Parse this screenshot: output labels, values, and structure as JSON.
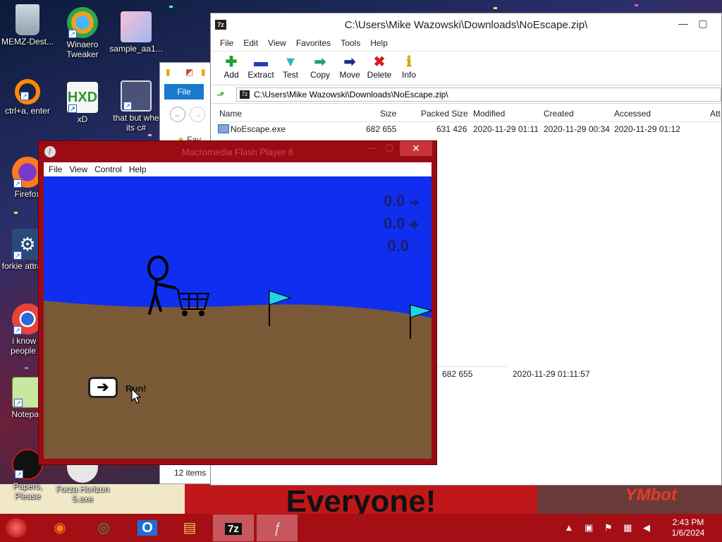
{
  "desktop": {
    "icons": [
      {
        "label": "MEMZ-Dest..."
      },
      {
        "label": "Winaero Tweaker"
      },
      {
        "label": "sample_aa1..."
      },
      {
        "label": "ctrl+a, enter"
      },
      {
        "label": "xD"
      },
      {
        "label": "that but whe its c#"
      },
      {
        "label": "Firefox"
      },
      {
        "label": "forkie attracta"
      },
      {
        "label": "i know y people w"
      },
      {
        "label": "Notepad"
      },
      {
        "label": "Papers, Please"
      },
      {
        "label": "Forza Horizon 5.exe"
      }
    ],
    "banner_text": "Everyone!",
    "banner_right_text": "YMbot"
  },
  "zip_window": {
    "title": "C:\\Users\\Mike Wazowski\\Downloads\\NoEscape.zip\\",
    "app_badge": "7z",
    "menu": [
      "File",
      "Edit",
      "View",
      "Favorites",
      "Tools",
      "Help"
    ],
    "toolbar": [
      {
        "label": "Add",
        "icon": "add-plus-icon",
        "glyph": "✚",
        "color": "#1f9e2c"
      },
      {
        "label": "Extract",
        "icon": "extract-minus-icon",
        "glyph": "▬",
        "color": "#1d3fb8"
      },
      {
        "label": "Test",
        "icon": "test-check-icon",
        "glyph": "▼",
        "color": "#2bb3c9"
      },
      {
        "label": "Copy",
        "icon": "copy-arrow-icon",
        "glyph": "➡",
        "color": "#2a9a8a"
      },
      {
        "label": "Move",
        "icon": "move-arrow-icon",
        "glyph": "➡",
        "color": "#1a2a8a"
      },
      {
        "label": "Delete",
        "icon": "delete-x-icon",
        "glyph": "✖",
        "color": "#d61f1f"
      },
      {
        "label": "Info",
        "icon": "info-icon",
        "glyph": "ℹ",
        "color": "#d4a50a"
      }
    ],
    "address": "C:\\Users\\Mike Wazowski\\Downloads\\NoEscape.zip\\",
    "columns": [
      "Name",
      "Size",
      "Packed Size",
      "Modified",
      "Created",
      "Accessed",
      "Att"
    ],
    "rows": [
      {
        "name": "NoEscape.exe",
        "size": "682 655",
        "packed": "631 426",
        "modified": "2020-11-29 01:11",
        "created": "2020-11-29 00:34",
        "accessed": "2020-11-29 01:12"
      }
    ],
    "status": {
      "size": "682 655",
      "modified": "2020-11-29 01:11:57"
    }
  },
  "explorer": {
    "file_tab": "File",
    "items_count": "12 items",
    "nav_partial": "Fav"
  },
  "flash_window": {
    "title": "Macromedia Flash Player 8",
    "menu": [
      "File",
      "View",
      "Control",
      "Help"
    ],
    "readouts": [
      {
        "value": "0.0",
        "arrow": "➔"
      },
      {
        "value": "0.0",
        "arrow": "✚"
      },
      {
        "value": "0.0",
        "arrow": "↓"
      }
    ],
    "run_button_glyph": "➔",
    "run_label": "Run!",
    "colors": {
      "sky": "#0f2ef0",
      "ground": "#7a5a36",
      "flag": "#1fd6e4"
    }
  },
  "taskbar": {
    "apps": [
      {
        "name": "firefox-icon",
        "glyph": "◉",
        "color": "#ff7a1a"
      },
      {
        "name": "chrome-icon",
        "glyph": "◎",
        "color": "#2ea84a"
      },
      {
        "name": "outlook-icon",
        "glyph": "O",
        "color": "#1f6fd0"
      },
      {
        "name": "file-explorer-icon",
        "glyph": "▤",
        "color": "#f0c24a"
      },
      {
        "name": "7zip-icon",
        "glyph": "7z",
        "color": "#ffffff"
      },
      {
        "name": "flash-icon",
        "glyph": "ƒ",
        "color": "#dddddd"
      }
    ],
    "tray_icons": "▲ ▣ ⚑ ▦ ◀",
    "time": "2:43 PM",
    "date": "1/6/2024"
  }
}
